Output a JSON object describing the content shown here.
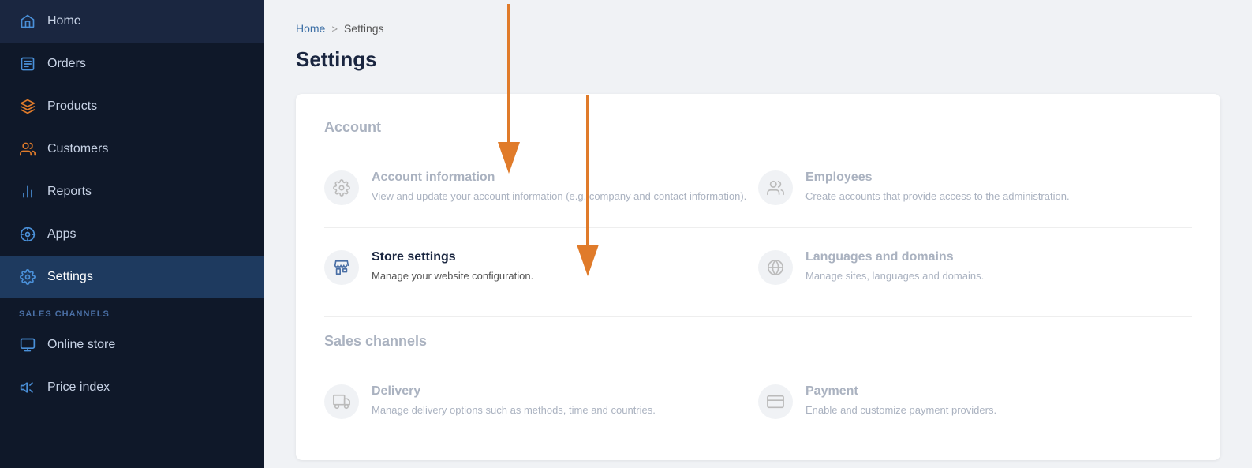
{
  "sidebar": {
    "items": [
      {
        "id": "home",
        "label": "Home",
        "icon": "home"
      },
      {
        "id": "orders",
        "label": "Orders",
        "icon": "orders"
      },
      {
        "id": "products",
        "label": "Products",
        "icon": "products"
      },
      {
        "id": "customers",
        "label": "Customers",
        "icon": "customers"
      },
      {
        "id": "reports",
        "label": "Reports",
        "icon": "reports"
      },
      {
        "id": "apps",
        "label": "Apps",
        "icon": "apps"
      },
      {
        "id": "settings",
        "label": "Settings",
        "icon": "settings",
        "active": true
      }
    ],
    "sales_channels_label": "SALES CHANNELS",
    "sales_channels_items": [
      {
        "id": "online-store",
        "label": "Online store",
        "icon": "store"
      },
      {
        "id": "price-index",
        "label": "Price index",
        "icon": "price"
      }
    ]
  },
  "breadcrumb": {
    "home": "Home",
    "separator": ">",
    "current": "Settings"
  },
  "page": {
    "title": "Settings"
  },
  "sections": [
    {
      "id": "account",
      "title": "Account",
      "items": [
        {
          "id": "account-information",
          "title": "Account information",
          "description": "View and update your account information (e.g. company and contact information).",
          "active": false
        },
        {
          "id": "employees",
          "title": "Employees",
          "description": "Create accounts that provide access to the administration.",
          "active": false
        },
        {
          "id": "store-settings",
          "title": "Store settings",
          "description": "Manage your website configuration.",
          "active": true
        },
        {
          "id": "languages-domains",
          "title": "Languages and domains",
          "description": "Manage sites, languages and domains.",
          "active": false
        }
      ]
    },
    {
      "id": "sales-channels",
      "title": "Sales channels",
      "items": [
        {
          "id": "delivery",
          "title": "Delivery",
          "description": "Manage delivery options such as methods, time and countries.",
          "active": false
        },
        {
          "id": "payment",
          "title": "Payment",
          "description": "Enable and customize payment providers.",
          "active": false
        }
      ]
    }
  ]
}
